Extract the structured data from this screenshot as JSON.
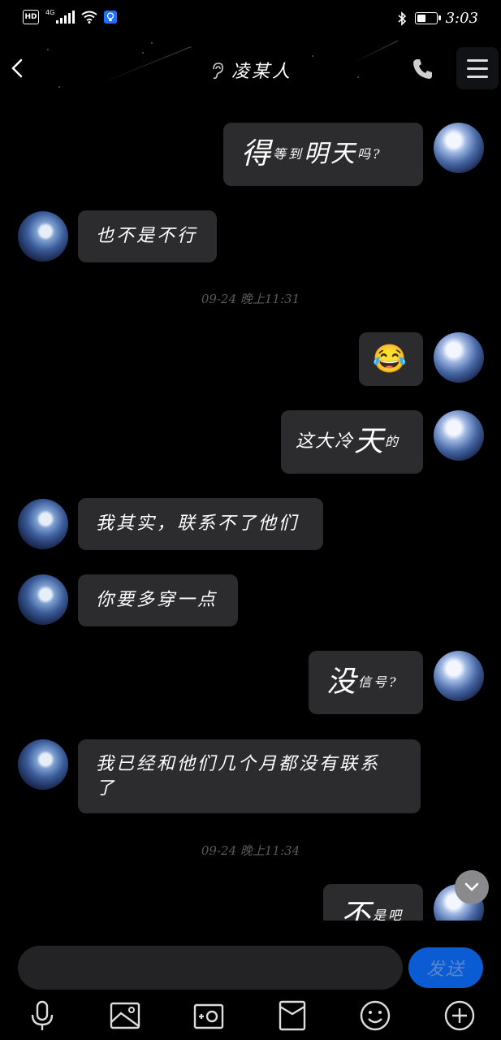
{
  "status_bar": {
    "time": "3:03",
    "network": "4G",
    "hd_label": "HD"
  },
  "header": {
    "title": "凌某人"
  },
  "messages": [
    {
      "side": "right",
      "parts": [
        {
          "t": "得",
          "s": "big"
        },
        {
          "t": "等到",
          "s": "sm"
        },
        {
          "t": "明天",
          "s": "big2"
        },
        {
          "t": "吗?",
          "s": "sm"
        }
      ]
    },
    {
      "side": "left",
      "text": "也不是不行"
    },
    {
      "side": "time",
      "text": "09-24 晚上11:31"
    },
    {
      "side": "right",
      "emoji": "😂"
    },
    {
      "side": "right",
      "parts": [
        {
          "t": "这大冷",
          "s": "md"
        },
        {
          "t": "天",
          "s": "big"
        },
        {
          "t": "的",
          "s": "sm"
        }
      ]
    },
    {
      "side": "left",
      "text": "我其实，联系不了他们"
    },
    {
      "side": "left",
      "text": "你要多穿一点"
    },
    {
      "side": "right",
      "parts": [
        {
          "t": "没",
          "s": "big"
        },
        {
          "t": "信号?",
          "s": "sm"
        }
      ]
    },
    {
      "side": "left",
      "text": "我已经和他们几个月都没有联系了"
    },
    {
      "side": "time",
      "text": "09-24 晚上11:34"
    },
    {
      "side": "right",
      "parts": [
        {
          "t": "不",
          "s": "big"
        },
        {
          "t": "是吧",
          "s": "sm"
        }
      ]
    }
  ],
  "msg_text": {
    "m1a": "得",
    "m1b": "等到",
    "m1c": "明天",
    "m1d": "吗?",
    "m2": "也不是不行",
    "t1": "09-24 晚上11:31",
    "m3": "😂",
    "m4a": "这大冷",
    "m4b": "天",
    "m4c": "的",
    "m5": "我其实，联系不了他们",
    "m6": "你要多穿一点",
    "m7a": "没",
    "m7b": "信号?",
    "m8a": "我已经和他们几个月都没有联系",
    "m8b": "了",
    "t2": "09-24 晚上11:34",
    "m9a": "不",
    "m9b": "是吧"
  },
  "input": {
    "placeholder": "",
    "send_label": "发送"
  },
  "toolbar": [
    "microphone-icon",
    "image-icon",
    "camera-icon",
    "red-packet-icon",
    "emoji-icon",
    "plus-icon"
  ],
  "colors": {
    "bubble": "#2c2c2e",
    "send": "#0b5bd3",
    "timestamp": "#5a5a5e"
  }
}
